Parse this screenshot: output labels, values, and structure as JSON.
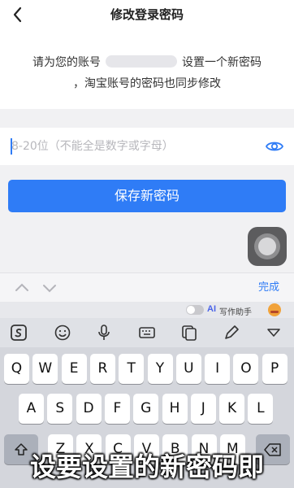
{
  "header": {
    "title": "修改登录密码",
    "back_icon": "chevron-left-icon"
  },
  "info": {
    "line1_before": "请为您的账号",
    "line1_after": "设置一个新密码",
    "line2": "，淘宝账号的密码也同步修改"
  },
  "password": {
    "placeholder": "8-20位（不能全是数字或字母）",
    "value": "",
    "toggle_icon": "eye-icon"
  },
  "save_button": {
    "label": "保存新密码",
    "color": "#2f7cf6"
  },
  "assistive_touch": {
    "icon": "assistive-touch-icon"
  },
  "accessory": {
    "done_label": "完成",
    "prev_icon": "chevron-up-icon",
    "next_icon": "chevron-down-icon"
  },
  "assistant": {
    "badge": "AI",
    "label": "写作助手"
  },
  "keyboard": {
    "toolbar_icons": [
      "sogou-logo-icon",
      "emoji-icon",
      "microphone-icon",
      "keyboard-icon",
      "clipboard-icon",
      "edit-icon",
      "collapse-icon"
    ],
    "row1": [
      "Q",
      "W",
      "E",
      "R",
      "T",
      "Y",
      "U",
      "I",
      "O",
      "P"
    ],
    "row2": [
      "A",
      "S",
      "D",
      "F",
      "G",
      "H",
      "J",
      "K",
      "L"
    ],
    "row3": [
      "Z",
      "X",
      "C",
      "V",
      "B",
      "N",
      "M"
    ]
  },
  "caption": "设要设置的新密码即"
}
